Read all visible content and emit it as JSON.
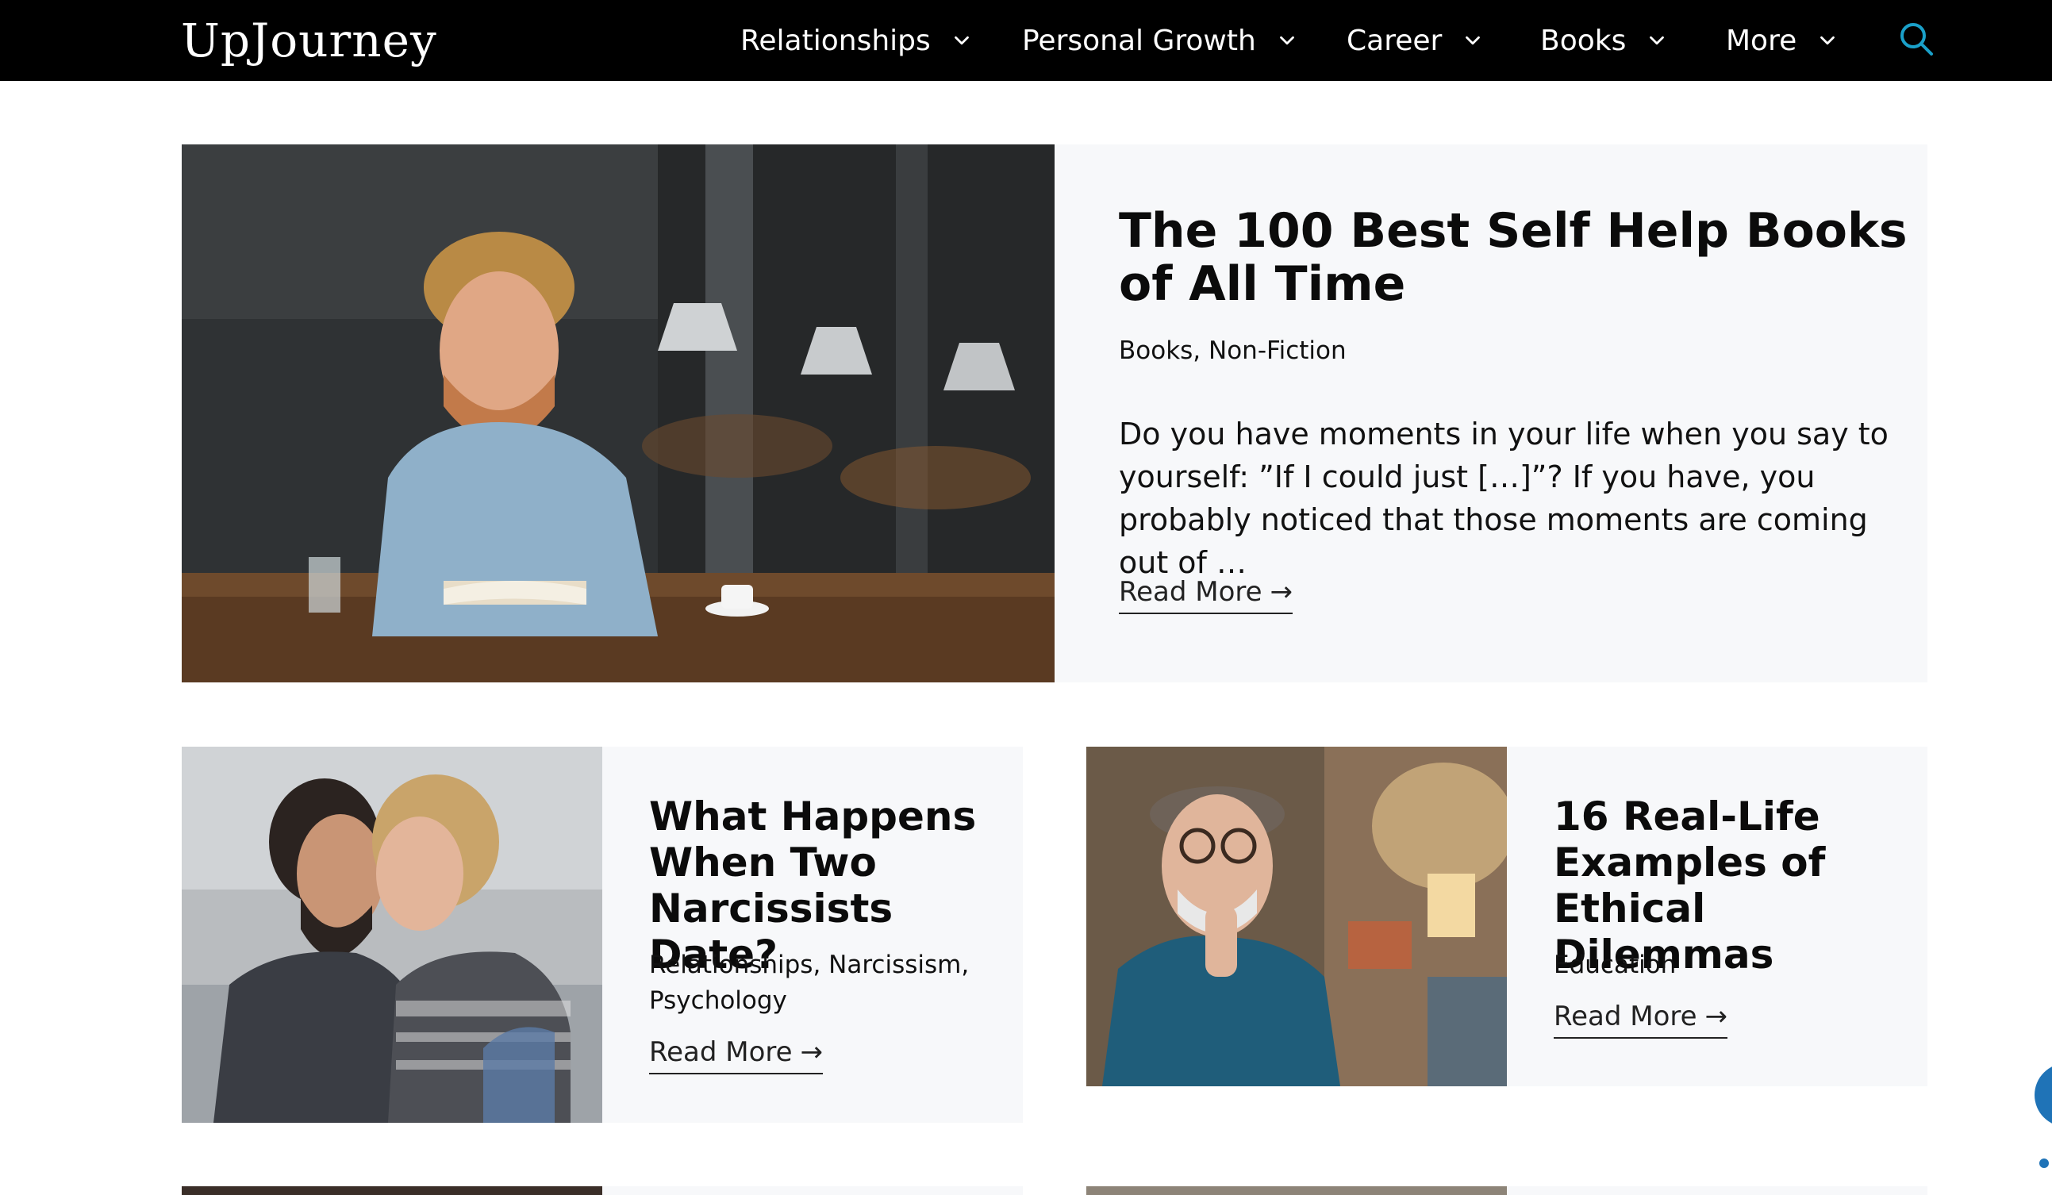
{
  "header": {
    "logo_text": "UpJourney",
    "nav": [
      {
        "label": "Relationships",
        "icon": "chevron-down-icon"
      },
      {
        "label": "Personal Growth",
        "icon": "chevron-down-icon"
      },
      {
        "label": "Career",
        "icon": "chevron-down-icon"
      },
      {
        "label": "Books",
        "icon": "chevron-down-icon"
      },
      {
        "label": "More",
        "icon": "chevron-down-icon"
      }
    ],
    "search_icon": "search-icon",
    "accent_color": "#1aa0c9"
  },
  "featured": {
    "title": "The 100 Best Self Help Books of All Time",
    "categories": "Books, Non-Fiction",
    "excerpt": "Do you have moments in your life when you say to yourself: ”If I could just […]”? If you have, you probably noticed that those moments are coming out of …",
    "read_more": "Read More",
    "image": "man-reading-book-in-cafe"
  },
  "posts": [
    {
      "title": "What Happens When Two Narcissists Date?",
      "categories": "Relationships, Narcissism, Psychology",
      "read_more": "Read More",
      "image": "couple-arguing"
    },
    {
      "title": "16 Real-Life Examples of Ethical Dilemmas",
      "categories": "Education",
      "read_more": "Read More",
      "image": "older-man-thinking"
    }
  ],
  "colors": {
    "header_bg": "#000000",
    "card_bg": "#f7f8fa",
    "chat_widget": "#1f73b7"
  }
}
